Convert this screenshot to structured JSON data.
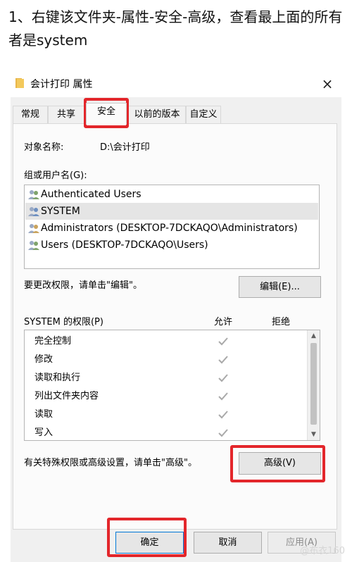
{
  "instruction": "1、右键该文件夹-属性-安全-高级，查看最上面的所有者是system",
  "dialog": {
    "title": "会计打印 属性",
    "close_glyph": "×",
    "tabs": [
      "常规",
      "共享",
      "安全",
      "以前的版本",
      "自定义"
    ],
    "active_tab": "安全",
    "object_label": "对象名称:",
    "object_value": "D:\\会计打印",
    "groups_label": "组或用户名(G):",
    "users": [
      "Authenticated Users",
      "SYSTEM",
      "Administrators (DESKTOP-7DCKAQO\\Administrators)",
      "Users (DESKTOP-7DCKAQO\\Users)"
    ],
    "selected_user": "SYSTEM",
    "edit_hint": "要更改权限，请单击\"编辑\"。",
    "edit_button": "编辑(E)...",
    "perm_header": "SYSTEM 的权限(P)",
    "allow_header": "允许",
    "deny_header": "拒绝",
    "permissions": [
      "完全控制",
      "修改",
      "读取和执行",
      "列出文件夹内容",
      "读取",
      "写入"
    ],
    "advanced_hint": "有关特殊权限或高级设置，请单击\"高级\"。",
    "advanced_button": "高级(V)",
    "ok_button": "确定",
    "cancel_button": "取消",
    "apply_button": "应用(A)"
  },
  "watermark": "@布衣160",
  "colors": {
    "highlight": "#e3262b",
    "check": "#a9a9a9",
    "selected_row": "#e5e5e5"
  }
}
